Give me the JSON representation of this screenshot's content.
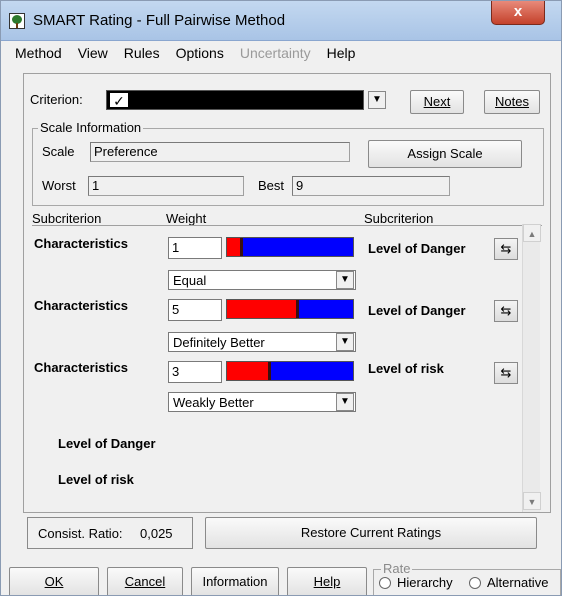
{
  "window": {
    "title": "SMART Rating - Full Pairwise Method",
    "close_label": "x"
  },
  "menu": [
    {
      "label": "Method",
      "enabled": true
    },
    {
      "label": "View",
      "enabled": true
    },
    {
      "label": "Rules",
      "enabled": true
    },
    {
      "label": "Options",
      "enabled": true
    },
    {
      "label": "Uncertainty",
      "enabled": false
    },
    {
      "label": "Help",
      "enabled": true
    }
  ],
  "criterion": {
    "label": "Criterion:",
    "checked_glyph": "✓",
    "next_label": "Next",
    "notes_label": "Notes"
  },
  "scale_info": {
    "title": "Scale Information",
    "scale_label": "Scale",
    "scale_value": "Preference",
    "assign_label": "Assign Scale",
    "worst_label": "Worst",
    "worst_value": "1",
    "best_label": "Best",
    "best_value": "9"
  },
  "columns": {
    "left": "Subcriterion",
    "weight": "Weight",
    "right": "Subcriterion"
  },
  "rows": [
    {
      "left": "Characteristics",
      "weight": "1",
      "red_fraction": 0.12,
      "relation": "Equal",
      "right": "Level of Danger"
    },
    {
      "left": "Characteristics",
      "weight": "5",
      "red_fraction": 0.56,
      "relation": "Definitely Better",
      "right": "Level of Danger"
    },
    {
      "left": "Characteristics",
      "weight": "3",
      "red_fraction": 0.34,
      "relation": "Weakly Better",
      "right": "Level of risk"
    }
  ],
  "pending": [
    "Level of Danger",
    "Level of risk"
  ],
  "footer": {
    "consist_label": "Consist. Ratio:",
    "consist_value": "0,025",
    "restore_label": "Restore Current Ratings"
  },
  "buttons": {
    "ok": "OK",
    "cancel": "Cancel",
    "information": "Information",
    "help": "Help"
  },
  "rate": {
    "title": "Rate",
    "hierarchy": "Hierarchy",
    "alternative": "Alternative"
  },
  "colors": {
    "favor_left": "#ff0000",
    "favor_right": "#0000ff"
  }
}
